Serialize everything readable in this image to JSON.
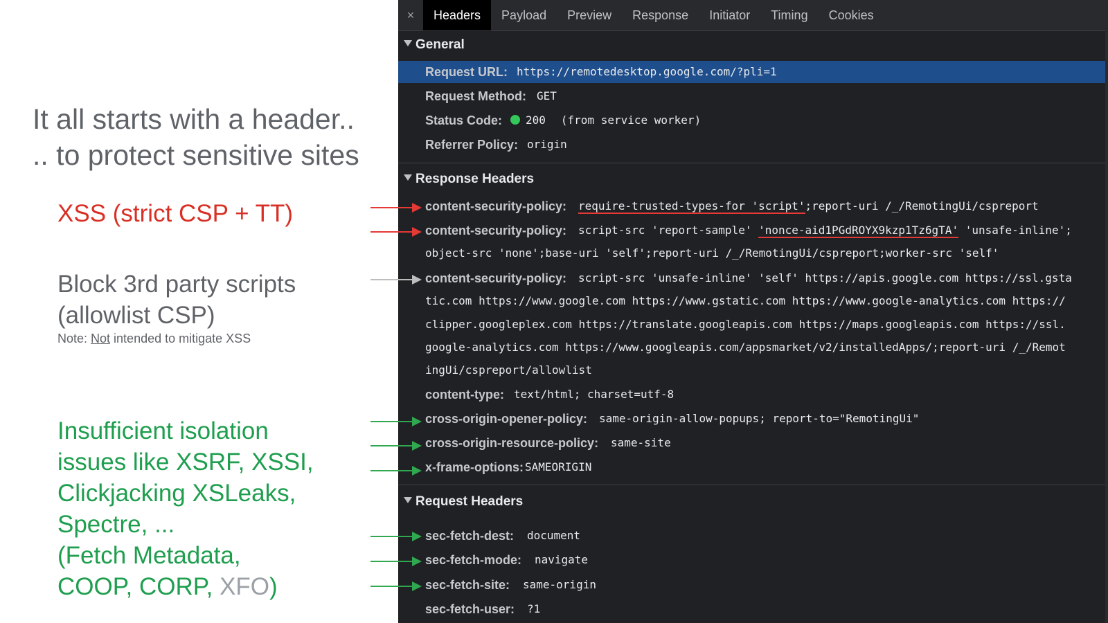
{
  "slide": {
    "title_line1": "It all starts with a header..",
    "title_line2": ".. to protect sensitive sites",
    "point_xss": "XSS (strict CSP + TT)",
    "point_block_line1": "Block 3rd party scripts",
    "point_block_line2": "(allowlist CSP)",
    "note_prefix": "Note: ",
    "note_underlined": "Not",
    "note_suffix": " intended to mitigate XSS",
    "point_iso_line1": "Insufficient isolation",
    "point_iso_line2": "issues like XSRF, XSSI,",
    "point_iso_line3": "Clickjacking XSLeaks,",
    "point_iso_line4": "Spectre, ...",
    "point_iso_line5": "(Fetch Metadata,",
    "point_iso_line6": "COOP, CORP, ",
    "point_iso_xfo": "XFO",
    "point_iso_close": ")"
  },
  "devtools": {
    "close_glyph": "×",
    "tabs": [
      "Headers",
      "Payload",
      "Preview",
      "Response",
      "Initiator",
      "Timing",
      "Cookies"
    ],
    "general": {
      "heading": "General",
      "request_url_key": "Request URL:",
      "request_url_val": "https://remotedesktop.google.com/?pli=1",
      "method_key": "Request Method:",
      "method_val": "GET",
      "status_key": "Status Code:",
      "status_val": "200",
      "status_note": "(from service worker)",
      "referrer_key": "Referrer Policy:",
      "referrer_val": "origin"
    },
    "response": {
      "heading": "Response Headers",
      "csp_key": "content-security-policy:",
      "csp1_ul": "require-trusted-types-for 'script'",
      "csp1_rest": ";report-uri /_/RemotingUi/cspreport",
      "csp2_a": "script-src 'report-sample' ",
      "csp2_ul": "'nonce-aid1PGdROYX9kzp1Tz6gTA'",
      "csp2_b": " 'unsafe-inline';",
      "csp2_line2": "object-src 'none';base-uri 'self';report-uri /_/RemotingUi/cspreport;worker-src 'self'",
      "csp3_line1": "script-src 'unsafe-inline' 'self' https://apis.google.com https://ssl.gsta",
      "csp3_line2": "tic.com https://www.google.com https://www.gstatic.com https://www.google-analytics.com https://",
      "csp3_line3": "clipper.googleplex.com https://translate.googleapis.com https://maps.googleapis.com https://ssl.",
      "csp3_line4": "google-analytics.com https://www.googleapis.com/appsmarket/v2/installedApps/;report-uri /_/Remot",
      "csp3_line5": "ingUi/cspreport/allowlist",
      "ctype_key": "content-type:",
      "ctype_val": "text/html; charset=utf-8",
      "coop_key": "cross-origin-opener-policy:",
      "coop_val": "same-origin-allow-popups; report-to=\"RemotingUi\"",
      "corp_key": "cross-origin-resource-policy:",
      "corp_val": "same-site",
      "xfo_key": "x-frame-options:",
      "xfo_val": "SAMEORIGIN"
    },
    "request": {
      "heading": "Request Headers",
      "dest_key": "sec-fetch-dest:",
      "dest_val": "document",
      "mode_key": "sec-fetch-mode:",
      "mode_val": "navigate",
      "site_key": "sec-fetch-site:",
      "site_val": "same-origin",
      "user_key": "sec-fetch-user:",
      "user_val": "?1"
    }
  },
  "colors": {
    "red": "#d93025",
    "green": "#1e9e4e",
    "gray": "#5f6368",
    "highlight": "#1f4e8c",
    "panel": "#202124"
  }
}
